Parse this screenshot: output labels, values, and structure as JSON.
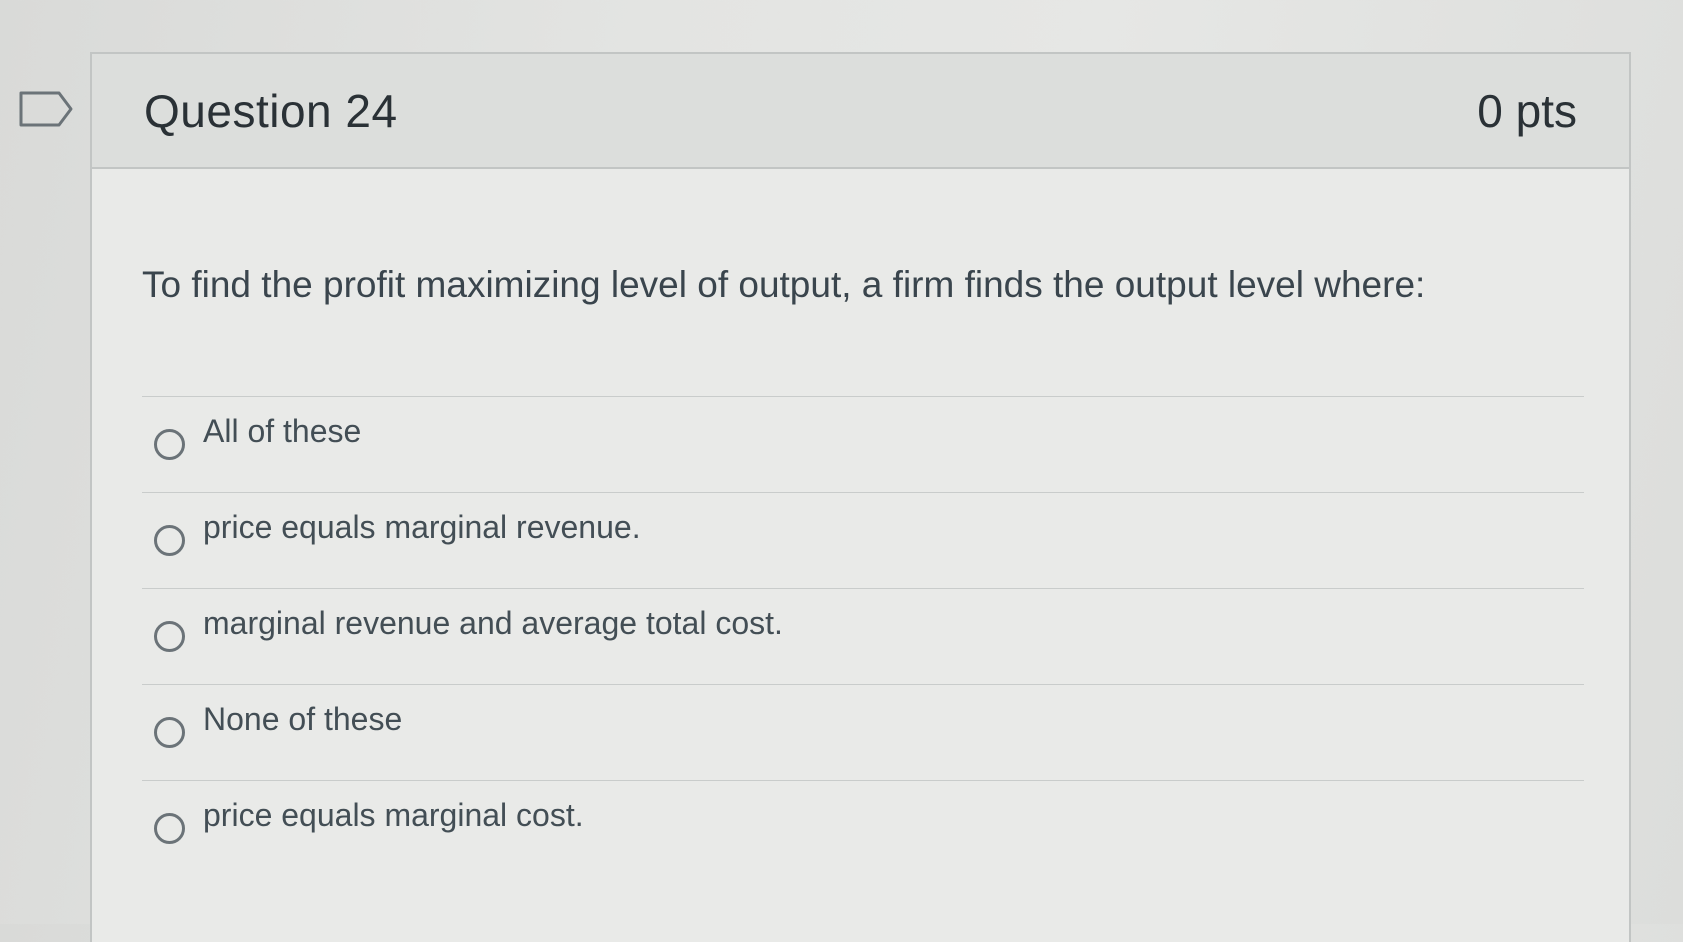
{
  "question": {
    "title": "Question 24",
    "points": "0 pts",
    "text": "To find the profit maximizing level of output, a firm finds the output level where:"
  },
  "answers": [
    {
      "label": "All of these",
      "selected": false
    },
    {
      "label": "price equals marginal revenue.",
      "selected": false
    },
    {
      "label": "marginal revenue and average total cost.",
      "selected": false
    },
    {
      "label": "None of these",
      "selected": false
    },
    {
      "label": "price equals marginal cost.",
      "selected": false
    }
  ],
  "icons": {
    "flag": "bookmark-flag-icon"
  },
  "colors": {
    "header_bg": "#dcdedc",
    "body_bg": "#e9eae8",
    "border": "#c2c5c4",
    "text": "#2a3136"
  }
}
